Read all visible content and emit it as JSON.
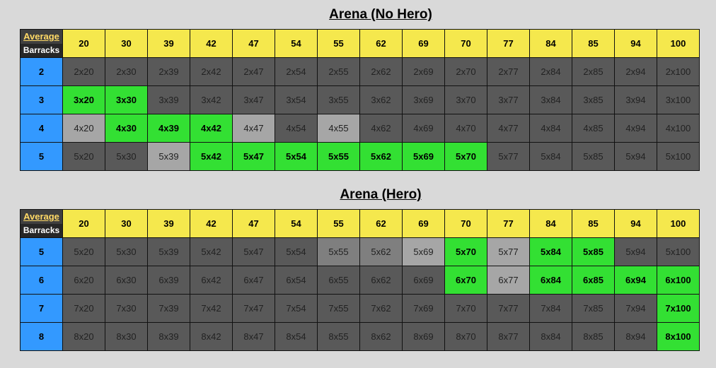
{
  "tables": [
    {
      "title": "Arena (No Hero)",
      "corner_top": "Average",
      "corner_bottom": "Barracks",
      "columns": [
        "20",
        "30",
        "39",
        "42",
        "47",
        "54",
        "55",
        "62",
        "69",
        "70",
        "77",
        "84",
        "85",
        "94",
        "100"
      ],
      "rows": [
        {
          "label": "2",
          "cells": [
            {
              "text": "2x20",
              "status": "dark"
            },
            {
              "text": "2x30",
              "status": "dark"
            },
            {
              "text": "2x39",
              "status": "dark"
            },
            {
              "text": "2x42",
              "status": "dark"
            },
            {
              "text": "2x47",
              "status": "dark"
            },
            {
              "text": "2x54",
              "status": "dark"
            },
            {
              "text": "2x55",
              "status": "dark"
            },
            {
              "text": "2x62",
              "status": "dark"
            },
            {
              "text": "2x69",
              "status": "dark"
            },
            {
              "text": "2x70",
              "status": "dark"
            },
            {
              "text": "2x77",
              "status": "dark"
            },
            {
              "text": "2x84",
              "status": "dark"
            },
            {
              "text": "2x85",
              "status": "dark"
            },
            {
              "text": "2x94",
              "status": "dark"
            },
            {
              "text": "2x100",
              "status": "dark"
            }
          ]
        },
        {
          "label": "3",
          "cells": [
            {
              "text": "3x20",
              "status": "green"
            },
            {
              "text": "3x30",
              "status": "green"
            },
            {
              "text": "3x39",
              "status": "dark"
            },
            {
              "text": "3x42",
              "status": "dark"
            },
            {
              "text": "3x47",
              "status": "dark"
            },
            {
              "text": "3x54",
              "status": "dark"
            },
            {
              "text": "3x55",
              "status": "dark"
            },
            {
              "text": "3x62",
              "status": "dark"
            },
            {
              "text": "3x69",
              "status": "dark"
            },
            {
              "text": "3x70",
              "status": "dark"
            },
            {
              "text": "3x77",
              "status": "dark"
            },
            {
              "text": "3x84",
              "status": "dark"
            },
            {
              "text": "3x85",
              "status": "dark"
            },
            {
              "text": "3x94",
              "status": "dark"
            },
            {
              "text": "3x100",
              "status": "dark"
            }
          ]
        },
        {
          "label": "4",
          "cells": [
            {
              "text": "4x20",
              "status": "light"
            },
            {
              "text": "4x30",
              "status": "green"
            },
            {
              "text": "4x39",
              "status": "green"
            },
            {
              "text": "4x42",
              "status": "green"
            },
            {
              "text": "4x47",
              "status": "light"
            },
            {
              "text": "4x54",
              "status": "dark"
            },
            {
              "text": "4x55",
              "status": "light"
            },
            {
              "text": "4x62",
              "status": "dark"
            },
            {
              "text": "4x69",
              "status": "dark"
            },
            {
              "text": "4x70",
              "status": "dark"
            },
            {
              "text": "4x77",
              "status": "dark"
            },
            {
              "text": "4x84",
              "status": "dark"
            },
            {
              "text": "4x85",
              "status": "dark"
            },
            {
              "text": "4x94",
              "status": "dark"
            },
            {
              "text": "4x100",
              "status": "dark"
            }
          ]
        },
        {
          "label": "5",
          "cells": [
            {
              "text": "5x20",
              "status": "dark"
            },
            {
              "text": "5x30",
              "status": "dark"
            },
            {
              "text": "5x39",
              "status": "light"
            },
            {
              "text": "5x42",
              "status": "green"
            },
            {
              "text": "5x47",
              "status": "green"
            },
            {
              "text": "5x54",
              "status": "green"
            },
            {
              "text": "5x55",
              "status": "green"
            },
            {
              "text": "5x62",
              "status": "green"
            },
            {
              "text": "5x69",
              "status": "green"
            },
            {
              "text": "5x70",
              "status": "green"
            },
            {
              "text": "5x77",
              "status": "dark"
            },
            {
              "text": "5x84",
              "status": "dark"
            },
            {
              "text": "5x85",
              "status": "dark"
            },
            {
              "text": "5x94",
              "status": "dark"
            },
            {
              "text": "5x100",
              "status": "dark"
            }
          ]
        }
      ]
    },
    {
      "title": "Arena (Hero)",
      "corner_top": "Average",
      "corner_bottom": "Barracks",
      "columns": [
        "20",
        "30",
        "39",
        "42",
        "47",
        "54",
        "55",
        "62",
        "69",
        "70",
        "77",
        "84",
        "85",
        "94",
        "100"
      ],
      "rows": [
        {
          "label": "5",
          "cells": [
            {
              "text": "5x20",
              "status": "dark"
            },
            {
              "text": "5x30",
              "status": "dark"
            },
            {
              "text": "5x39",
              "status": "dark"
            },
            {
              "text": "5x42",
              "status": "dark"
            },
            {
              "text": "5x47",
              "status": "dark"
            },
            {
              "text": "5x54",
              "status": "dark"
            },
            {
              "text": "5x55",
              "status": "mid"
            },
            {
              "text": "5x62",
              "status": "mid"
            },
            {
              "text": "5x69",
              "status": "light"
            },
            {
              "text": "5x70",
              "status": "green"
            },
            {
              "text": "5x77",
              "status": "light"
            },
            {
              "text": "5x84",
              "status": "green"
            },
            {
              "text": "5x85",
              "status": "green"
            },
            {
              "text": "5x94",
              "status": "dark"
            },
            {
              "text": "5x100",
              "status": "dark"
            }
          ]
        },
        {
          "label": "6",
          "cells": [
            {
              "text": "6x20",
              "status": "dark"
            },
            {
              "text": "6x30",
              "status": "dark"
            },
            {
              "text": "6x39",
              "status": "dark"
            },
            {
              "text": "6x42",
              "status": "dark"
            },
            {
              "text": "6x47",
              "status": "dark"
            },
            {
              "text": "6x54",
              "status": "dark"
            },
            {
              "text": "6x55",
              "status": "dark"
            },
            {
              "text": "6x62",
              "status": "dark"
            },
            {
              "text": "6x69",
              "status": "dark"
            },
            {
              "text": "6x70",
              "status": "green"
            },
            {
              "text": "6x77",
              "status": "light"
            },
            {
              "text": "6x84",
              "status": "green"
            },
            {
              "text": "6x85",
              "status": "green"
            },
            {
              "text": "6x94",
              "status": "green"
            },
            {
              "text": "6x100",
              "status": "green"
            }
          ]
        },
        {
          "label": "7",
          "cells": [
            {
              "text": "7x20",
              "status": "dark"
            },
            {
              "text": "7x30",
              "status": "dark"
            },
            {
              "text": "7x39",
              "status": "dark"
            },
            {
              "text": "7x42",
              "status": "dark"
            },
            {
              "text": "7x47",
              "status": "dark"
            },
            {
              "text": "7x54",
              "status": "dark"
            },
            {
              "text": "7x55",
              "status": "dark"
            },
            {
              "text": "7x62",
              "status": "dark"
            },
            {
              "text": "7x69",
              "status": "dark"
            },
            {
              "text": "7x70",
              "status": "dark"
            },
            {
              "text": "7x77",
              "status": "dark"
            },
            {
              "text": "7x84",
              "status": "dark"
            },
            {
              "text": "7x85",
              "status": "dark"
            },
            {
              "text": "7x94",
              "status": "dark"
            },
            {
              "text": "7x100",
              "status": "green"
            }
          ]
        },
        {
          "label": "8",
          "cells": [
            {
              "text": "8x20",
              "status": "dark"
            },
            {
              "text": "8x30",
              "status": "dark"
            },
            {
              "text": "8x39",
              "status": "dark"
            },
            {
              "text": "8x42",
              "status": "dark"
            },
            {
              "text": "8x47",
              "status": "dark"
            },
            {
              "text": "8x54",
              "status": "dark"
            },
            {
              "text": "8x55",
              "status": "dark"
            },
            {
              "text": "8x62",
              "status": "dark"
            },
            {
              "text": "8x69",
              "status": "dark"
            },
            {
              "text": "8x70",
              "status": "dark"
            },
            {
              "text": "8x77",
              "status": "dark"
            },
            {
              "text": "8x84",
              "status": "dark"
            },
            {
              "text": "8x85",
              "status": "dark"
            },
            {
              "text": "8x94",
              "status": "dark"
            },
            {
              "text": "8x100",
              "status": "green"
            }
          ]
        }
      ]
    }
  ],
  "colors": {
    "header_yellow": "#f5e84d",
    "row_header_blue": "#3399ff",
    "green": "#33e033",
    "dark": "#595959",
    "mid": "#7f7f7f",
    "light": "#a6a6a6",
    "background": "#d9d9d9"
  }
}
